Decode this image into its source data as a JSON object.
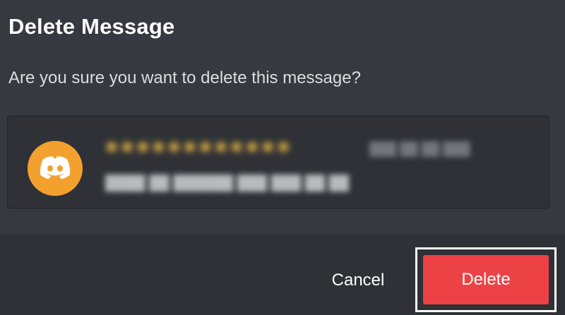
{
  "dialog": {
    "title": "Delete Message",
    "prompt": "Are you sure you want to delete this message?"
  },
  "message_preview": {
    "avatar_icon": "discord-logo-icon",
    "avatar_color": "#f2a12f",
    "username_color": "#f7c244"
  },
  "footer": {
    "cancel_label": "Cancel",
    "delete_label": "Delete",
    "delete_color": "#ed4245"
  }
}
